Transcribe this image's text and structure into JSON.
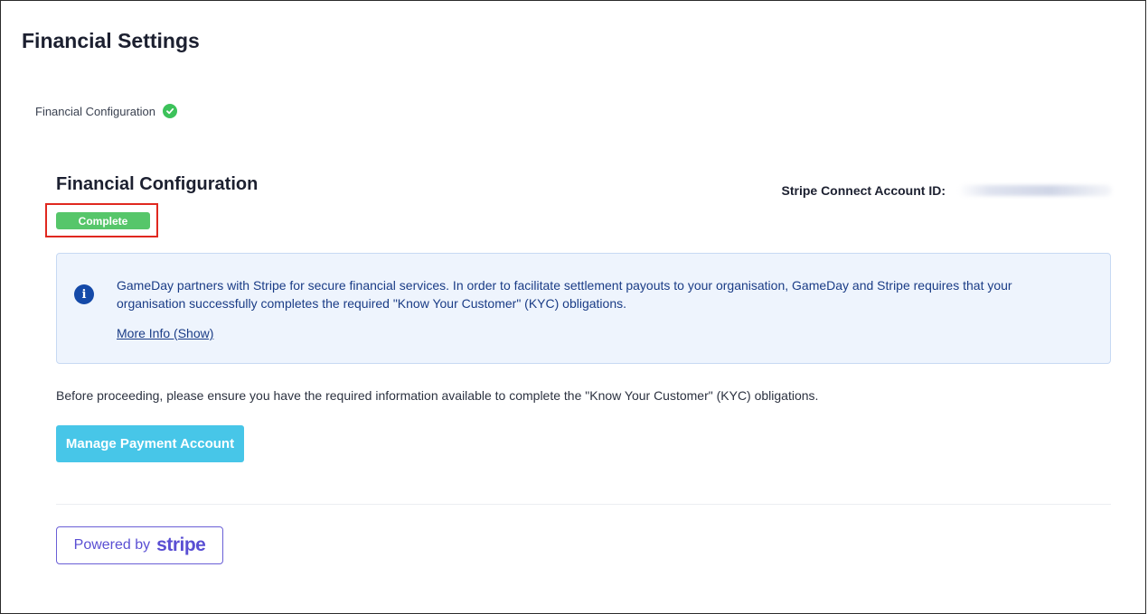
{
  "page": {
    "title": "Financial Settings"
  },
  "progress": {
    "step_label": "Financial Configuration",
    "step_icon": "check-circle-icon",
    "step_complete": true
  },
  "section": {
    "title": "Financial Configuration",
    "status": "Complete",
    "account_id_label": "Stripe Connect Account ID:"
  },
  "info": {
    "icon": "info-icon",
    "text": "GameDay partners with Stripe for secure financial services. In order to facilitate settlement payouts to your organisation, GameDay and Stripe requires that your organisation successfully completes the required \"Know Your Customer\" (KYC) obligations.",
    "more_info_link": "More Info (Show)"
  },
  "note": "Before proceeding, please ensure you have the required information available to complete the \"Know Your Customer\" (KYC) obligations.",
  "actions": {
    "manage_button": "Manage Payment Account"
  },
  "footer": {
    "powered_by": "Powered by",
    "brand": "stripe"
  },
  "colors": {
    "success": "#56c66a",
    "info_bg": "#eef4fd",
    "info_text": "#1a3c86",
    "primary_button": "#47c6e8",
    "stripe_purple": "#5a4fd3",
    "highlight_border": "#e0281f"
  }
}
